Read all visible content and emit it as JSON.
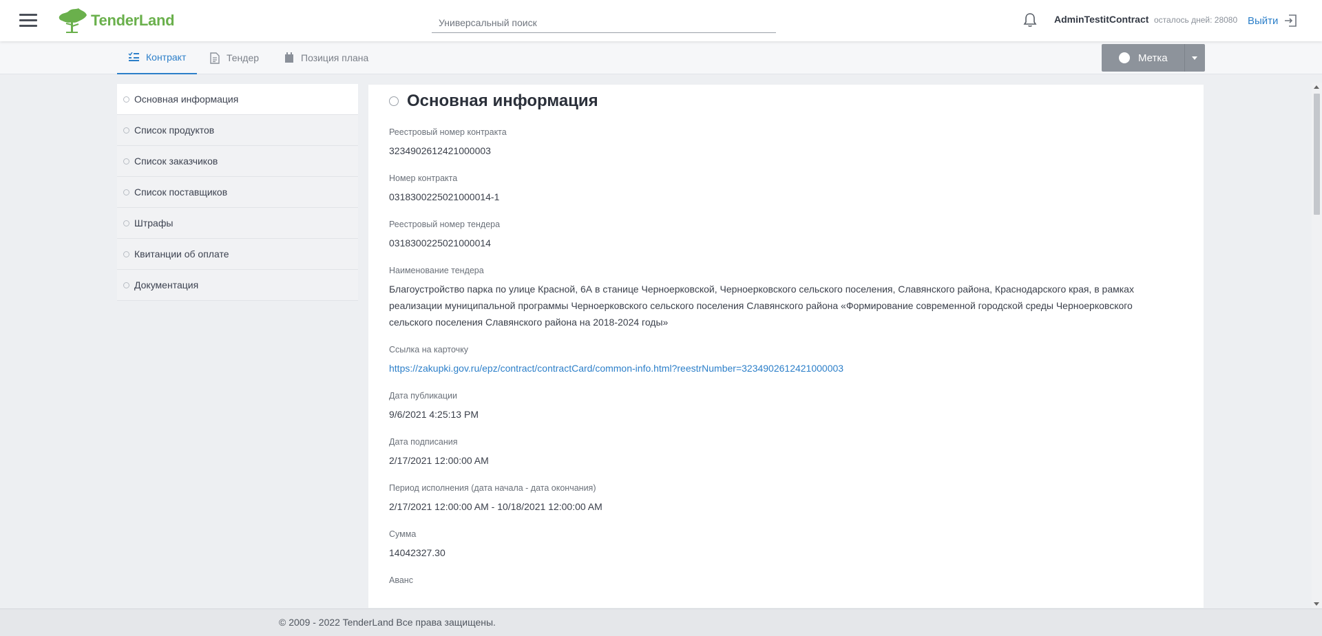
{
  "header": {
    "logo_text": "TenderLand",
    "search_placeholder": "Универсальный поиск",
    "username": "AdminTestitContract",
    "days_left": "осталось дней: 28080",
    "logout_label": "Выйти"
  },
  "tabs": [
    {
      "label": "Контракт",
      "icon": "contract-icon",
      "active": true
    },
    {
      "label": "Тендер",
      "icon": "document-icon",
      "active": false
    },
    {
      "label": "Позиция плана",
      "icon": "plan-icon",
      "active": false
    }
  ],
  "label_button": {
    "label": "Метка"
  },
  "sidebar": {
    "items": [
      {
        "label": "Основная информация",
        "active": true
      },
      {
        "label": "Список продуктов"
      },
      {
        "label": "Список заказчиков"
      },
      {
        "label": "Список поставщиков"
      },
      {
        "label": "Штрафы"
      },
      {
        "label": "Квитанции об оплате"
      },
      {
        "label": "Документация"
      }
    ]
  },
  "main": {
    "title": "Основная информация",
    "fields": [
      {
        "label": "Реестровый номер контракта",
        "value": "3234902612421000003"
      },
      {
        "label": "Номер контракта",
        "value": "0318300225021000014-1"
      },
      {
        "label": "Реестровый номер тендера",
        "value": "0318300225021000014"
      },
      {
        "label": "Наименование тендера",
        "value": "Благоустройство парка по улице Красной, 6А в станице Черноерковской, Черноерковского сельского поселения, Славянского района, Краснодарского края, в рамках реализации муниципальной программы Черноерковского сельского поселения Славянского района «Формирование современной городской среды Черноерковского сельского поселения Славянского района на 2018-2024 годы»"
      },
      {
        "label": "Ссылка на карточку",
        "value": "https://zakupki.gov.ru/epz/contract/contractCard/common-info.html?reestrNumber=3234902612421000003",
        "link": true
      },
      {
        "label": "Дата публикации",
        "value": "9/6/2021 4:25:13 PM"
      },
      {
        "label": "Дата подписания",
        "value": "2/17/2021 12:00:00 AM"
      },
      {
        "label": "Период исполнения (дата начала - дата окончания)",
        "value": "2/17/2021 12:00:00 AM - 10/18/2021 12:00:00 AM"
      },
      {
        "label": "Сумма",
        "value": "14042327.30"
      },
      {
        "label": "Аванс",
        "value": ""
      }
    ]
  },
  "footer": {
    "text": "© 2009 - 2022 TenderLand Все права защищены."
  },
  "colors": {
    "accent": "#2c7fc9",
    "brand": "#6ab04c",
    "button": "#8d939b"
  }
}
